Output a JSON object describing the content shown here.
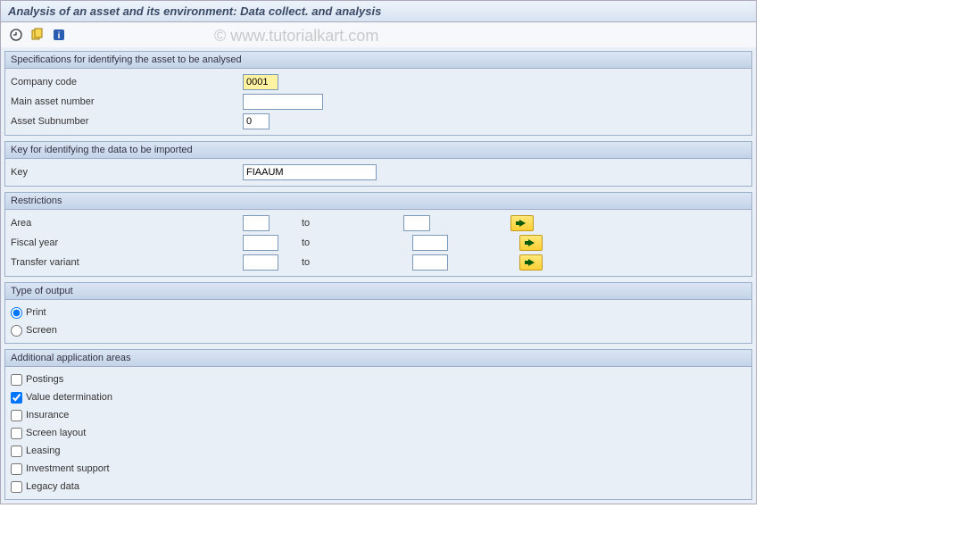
{
  "title": "Analysis of an asset and its environment: Data collect. and analysis",
  "watermark": "© www.tutorialkart.com",
  "toolbar": {
    "execute_icon": "execute",
    "variant_icon": "variant",
    "info_icon": "info"
  },
  "group1": {
    "title": "Specifications for identifying the asset to be analysed",
    "company_code_label": "Company code",
    "company_code_value": "0001",
    "main_asset_label": "Main asset number",
    "main_asset_value": "",
    "subnumber_label": "Asset Subnumber",
    "subnumber_value": "0"
  },
  "group2": {
    "title": "Key for identifying the data to be imported",
    "key_label": "Key",
    "key_value": "FIAAUM"
  },
  "group3": {
    "title": "Restrictions",
    "to_label": "to",
    "rows": [
      {
        "label": "Area",
        "from": "",
        "to": ""
      },
      {
        "label": "Fiscal year",
        "from": "",
        "to": ""
      },
      {
        "label": "Transfer variant",
        "from": "",
        "to": ""
      }
    ]
  },
  "group4": {
    "title": "Type of output",
    "print_label": "Print",
    "screen_label": "Screen",
    "selected": "print"
  },
  "group5": {
    "title": "Additional application areas",
    "items": [
      {
        "label": "Postings",
        "checked": false
      },
      {
        "label": "Value determination",
        "checked": true
      },
      {
        "label": "Insurance",
        "checked": false
      },
      {
        "label": "Screen layout",
        "checked": false
      },
      {
        "label": "Leasing",
        "checked": false
      },
      {
        "label": "Investment support",
        "checked": false
      },
      {
        "label": "Legacy data",
        "checked": false
      }
    ]
  }
}
